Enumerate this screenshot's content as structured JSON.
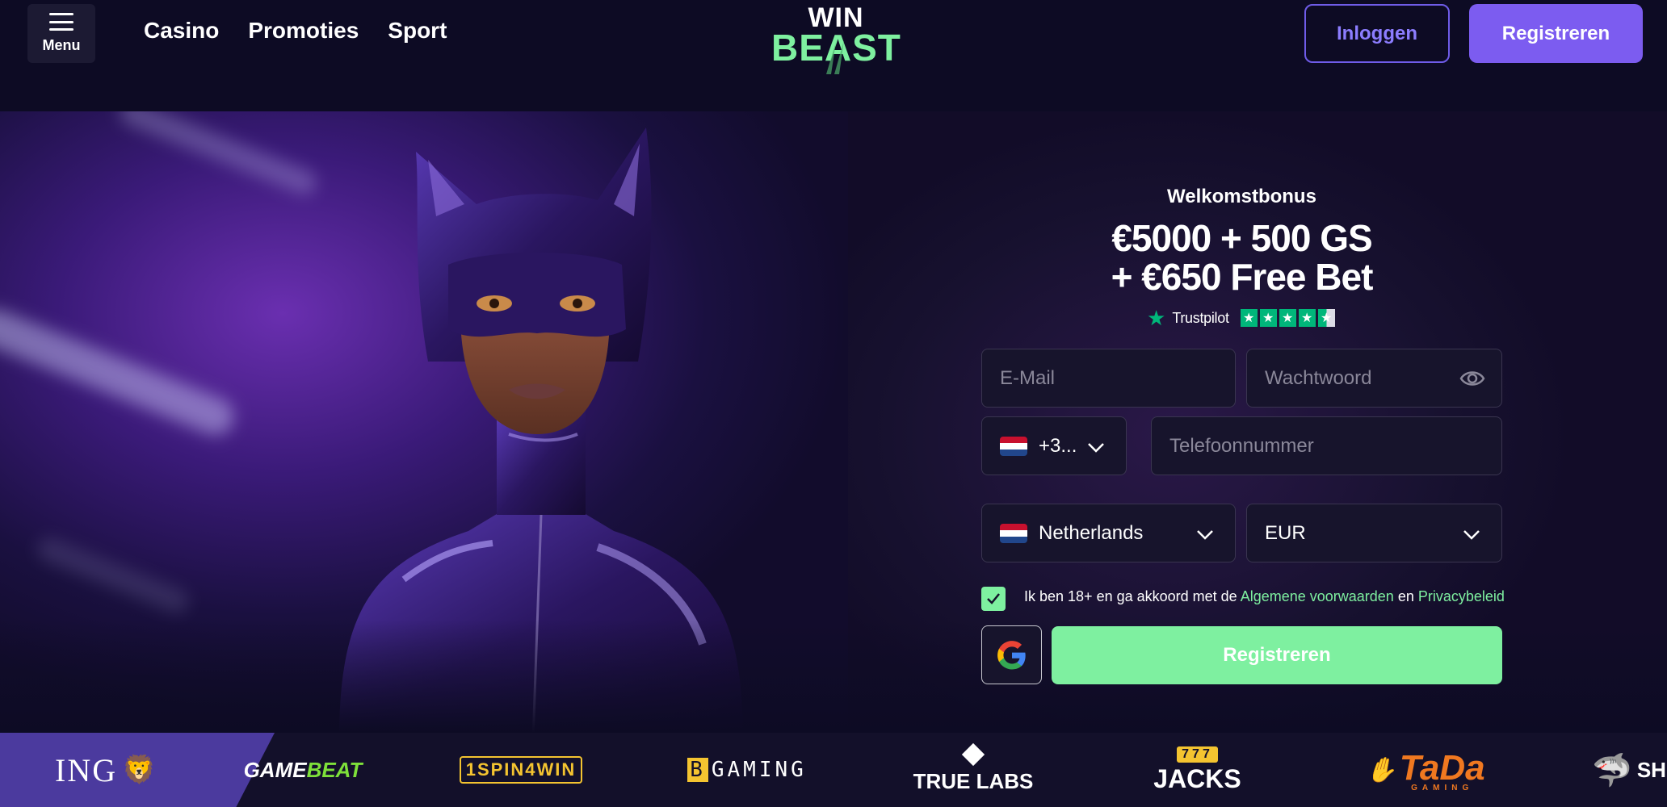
{
  "header": {
    "menu_label": "Menu",
    "nav": [
      "Casino",
      "Promoties",
      "Sport"
    ],
    "logo_top": "WIN",
    "logo_bottom": "BEAST",
    "login_label": "Inloggen",
    "register_label": "Registreren"
  },
  "promo": {
    "subtitle": "Welkomstbonus",
    "line1": "€5000 + 500 GS",
    "line2": "+ €650 Free Bet",
    "trustpilot_label": "Trustpilot",
    "trustpilot_rating": 4.5
  },
  "form": {
    "email_placeholder": "E-Mail",
    "password_placeholder": "Wachtwoord",
    "phone_code": "+3...",
    "phone_placeholder": "Telefoonnummer",
    "country": "Netherlands",
    "currency": "EUR",
    "terms_prefix": "Ik ben 18+ en ga akkoord met de",
    "terms_link": "Algemene voorwaarden",
    "terms_and": "en",
    "privacy_link": "Privacybeleid",
    "terms_checked": true,
    "submit_label": "Registreren"
  },
  "providers": {
    "ing": "ING",
    "gamebeat_a": "GAME",
    "gamebeat_b": "BEAT",
    "spinwin": "1SPIN4WIN",
    "bgaming_b": "B",
    "bgaming_rest": "GAMING",
    "truelabs": "TRUE LABS",
    "jacks_num": "777",
    "jacks": "JACKS",
    "tada": "TaDa",
    "tada_sub": "GAMING",
    "shark": "SH"
  },
  "colors": {
    "accent_purple": "#7c5cf0",
    "accent_green": "#7ef0a0",
    "background": "#0d0b24"
  }
}
